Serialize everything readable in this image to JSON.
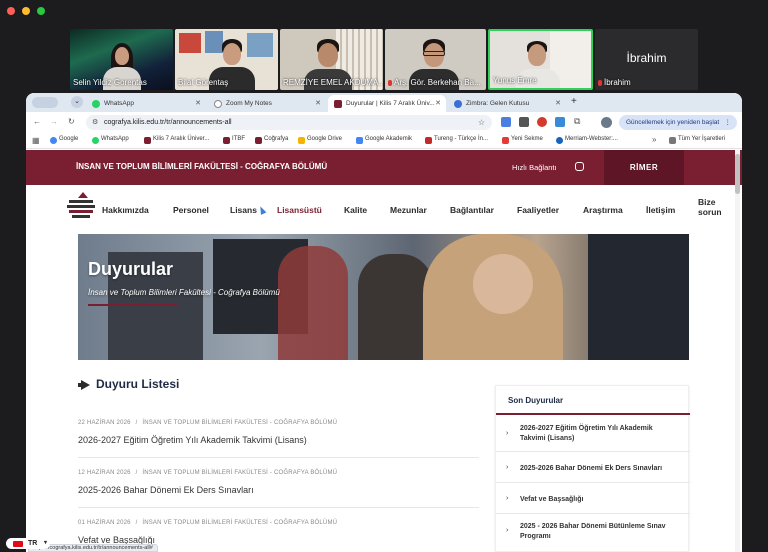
{
  "participants": [
    {
      "name": "Selin Yildiz Gorentas",
      "muted": false
    },
    {
      "name": "Bilal Görentaş",
      "muted": false
    },
    {
      "name": "REMZİYE EMEL AKDUMA...",
      "muted": false
    },
    {
      "name": "Arş. Gör. Berkehan Ba...",
      "muted": true
    },
    {
      "name": "Yunus Emre",
      "muted": false
    },
    {
      "name": "İbrahim",
      "muted": true,
      "big_name": "İbrahim"
    }
  ],
  "colors": {
    "brand": "#7a1f31",
    "active_speaker": "#2fd158",
    "accent_blue": "#1a73e8"
  },
  "tabs": [
    {
      "label": "WhatsApp",
      "icon": "whatsapp-icon"
    },
    {
      "label": "Zoom My Notes",
      "icon": "page-icon"
    },
    {
      "label": "Duyurular | Kilis 7 Aralık Üniv...",
      "icon": "kilis-icon"
    },
    {
      "label": "Zimbra: Gelen Kutusu",
      "icon": "zimbra-icon"
    }
  ],
  "new_tab": "+",
  "address": "cografya.kilis.edu.tr/tr/announcements-all",
  "update_button": "Güncellemek için yeniden başlat",
  "bookmarks": [
    {
      "label": "Google",
      "color": "#4285f4"
    },
    {
      "label": "WhatsApp",
      "color": "#25d366"
    },
    {
      "label": "Kilis 7 Aralık Üniver...",
      "color": "#7a1f31"
    },
    {
      "label": "ITBF",
      "color": "#7a1f31"
    },
    {
      "label": "Coğrafya",
      "color": "#7a1f31"
    },
    {
      "label": "Google Drive",
      "color": "#f4b400"
    },
    {
      "label": "Google Akademik",
      "color": "#4285f4"
    },
    {
      "label": "Tureng - Türkçe İn...",
      "color": "#c62828"
    },
    {
      "label": "Yeni Sekme",
      "color": "#e53935"
    },
    {
      "label": "Merriam-Webster:...",
      "color": "#1565c0"
    }
  ],
  "bookmarks_more": "»",
  "all_bookmarks": "Tüm Yer İşaretleri",
  "site": {
    "header_title": "İNSAN VE TOPLUM BİLİMLERİ FAKÜLTESİ - COĞRAFYA BÖLÜMÜ",
    "quick_link": "Hızlı Bağlantı",
    "rimer": "RİMER",
    "nav": [
      "Hakkımızda",
      "Personel",
      "Lisans",
      "Lisansüstü",
      "Kalite",
      "Mezunlar",
      "Bağlantılar",
      "Faaliyetler",
      "Araştırma",
      "İletişim"
    ],
    "nav_last": [
      "Bize",
      "sorun"
    ],
    "hero_title": "Duyurular",
    "hero_subtitle": "İnsan ve Toplum Bilimleri Fakültesi - Coğrafya Bölümü"
  },
  "list_title": "Duyuru Listesi",
  "announcements": [
    {
      "date": "22 HAZİRAN 2026",
      "faculty": "İNSAN VE TOPLUM BİLİMLERİ FAKÜLTESİ - COĞRAFYA BÖLÜMÜ",
      "title": "2026-2027 Eğitim Öğretim Yılı Akademik Takvimi (Lisans)"
    },
    {
      "date": "12 HAZİRAN 2026",
      "faculty": "İNSAN VE TOPLUM BİLİMLERİ FAKÜLTESİ - COĞRAFYA BÖLÜMÜ",
      "title": "2025-2026 Bahar Dönemi Ek Ders Sınavları"
    },
    {
      "date": "01 HAZİRAN 2026",
      "faculty": "İNSAN VE TOPLUM BİLİMLERİ FAKÜLTESİ - COĞRAFYA BÖLÜMÜ",
      "title": "Vefat ve Başsağlığı"
    }
  ],
  "date_sep": "/",
  "sidebar_title": "Son Duyurular",
  "recent": [
    {
      "title": "2026-2027 Eğitim Öğretim Yılı Akademik Takvimi (Lisans)"
    },
    {
      "title": "2025-2026 Bahar Dönemi Ek Ders Sınavları"
    },
    {
      "title": "Vefat ve Başsağlığı"
    },
    {
      "title": "2025 - 2026 Bahar Dönemi Bütünleme Sınav Programı"
    }
  ],
  "status_url": "https://cografya.kilis.edu.tr/tr/announcements-all#",
  "input_lang": "TR"
}
